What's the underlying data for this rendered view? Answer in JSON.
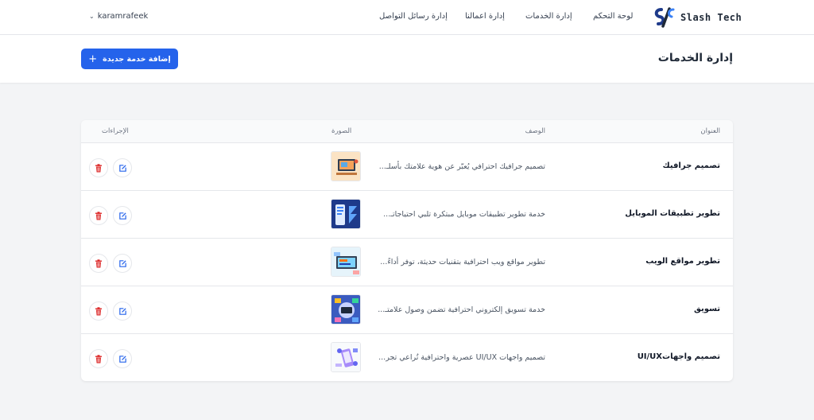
{
  "brand": {
    "name": "Slash Tech"
  },
  "nav": {
    "items": [
      {
        "label": "لوحة التحكم"
      },
      {
        "label": "إدارة الخدمات"
      },
      {
        "label": "إدارة اعمالنا"
      },
      {
        "label": "إدارة رسائل التواصل"
      }
    ],
    "user": "karamrafeek"
  },
  "header": {
    "title": "إدارة الخدمات",
    "add_button": "إضافة خدمة جديدة"
  },
  "table": {
    "columns": {
      "title": "العنوان",
      "description": "الوصف",
      "image": "الصورة",
      "actions": "الإجراءات"
    },
    "rows": [
      {
        "title": "تصميم جرافيك",
        "description": "تصميم جرافيك احترافي يُعبّر عن هوية علامتك بأسلـ..."
      },
      {
        "title": "تطوير تطبيقات الموبايل",
        "description": "خدمة تطوير تطبيقات موبايل مبتكرة تلبي احتياجاتـ..."
      },
      {
        "title": "تطوير مواقع الويب",
        "description": "تطوير مواقع ويب احترافية بتقنيات حديثة، توفر أداءً..."
      },
      {
        "title": "تسويق",
        "description": "خدمة تسويق إلكتروني احترافية تضمن وصول علامتـ..."
      },
      {
        "title": "تصميم واجهاتUI/UX",
        "description": "تصميم واجهات UI/UX عصرية واحترافية تُراعي تجر..."
      }
    ]
  },
  "colors": {
    "primary": "#2563eb",
    "danger": "#dc2626",
    "edit": "#2563eb"
  },
  "icons": {
    "add": "plus-icon",
    "edit": "edit-icon",
    "delete": "trash-icon",
    "user_menu": "chevron-down-icon"
  }
}
